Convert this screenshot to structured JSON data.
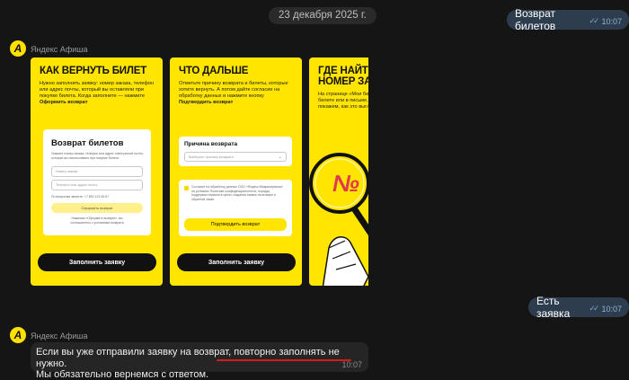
{
  "date_divider": "23 декабря 2025 г.",
  "outgoing": [
    {
      "text": "Возврат билетов",
      "time": "10:07"
    },
    {
      "text": "Есть заявка",
      "time": "10:07"
    }
  ],
  "sender_name": "Яндекс Афиша",
  "avatar_letter": "А",
  "cards": [
    {
      "title": "КАК ВЕРНУТЬ БИЛЕТ",
      "desc": "Нужно заполнить заявку: номер заказа, телефон или адрес почты, который вы оставляли при покупке билета. Когда заполните — нажмите ",
      "desc_bold": "Оформить возврат",
      "form_title": "Возврат билетов",
      "form_hint": "Укажите номер заказа, телефон или адрес электронной почты, которые вы использовали при покупке билета",
      "field1": "Номер заказа",
      "field2": "Телефон или адрес почты",
      "support": "По вопросам звоните: +7 800 123 45 67",
      "form_button": "Оформить возврат",
      "form_note": "Нажимая «Оформить возврат», вы соглашаетесь с условиями возврата",
      "button": "Заполнить заявку"
    },
    {
      "title": "ЧТО ДАЛЬШЕ",
      "desc": "Отметьте причину возврата и билеты, которые хотите вернуть. А потом дайте согласие на обработку данных и нажмите кнопку ",
      "desc_bold": "Подтвердить возврат",
      "reason_label": "Причина возврата",
      "reason_placeholder": "Выберите причину возврата",
      "consent": "Согласие на обработку данных ООО «Яндекс.Медиасервисы» на условиях Политики конфиденциальности, порядку поддержки сервиса в целях создания заявки на возврат и обратной связи",
      "confirm_button": "Подтвердить возврат",
      "button": "Заполнить заявку"
    },
    {
      "title": "ГДЕ НАЙТИ НОМЕР ЗАКАЗА",
      "desc": "На странице «Мои билеты» в билете или в письме, покажем, как это выглядит",
      "badge": "№"
    }
  ],
  "incoming": {
    "line1_a": "Если вы уже отправили заявку на возврат, ",
    "line1_b": "повторно заполнять не нужно.",
    "line2": "Мы обязательно вернемся с ответом.",
    "time": "10:07"
  }
}
